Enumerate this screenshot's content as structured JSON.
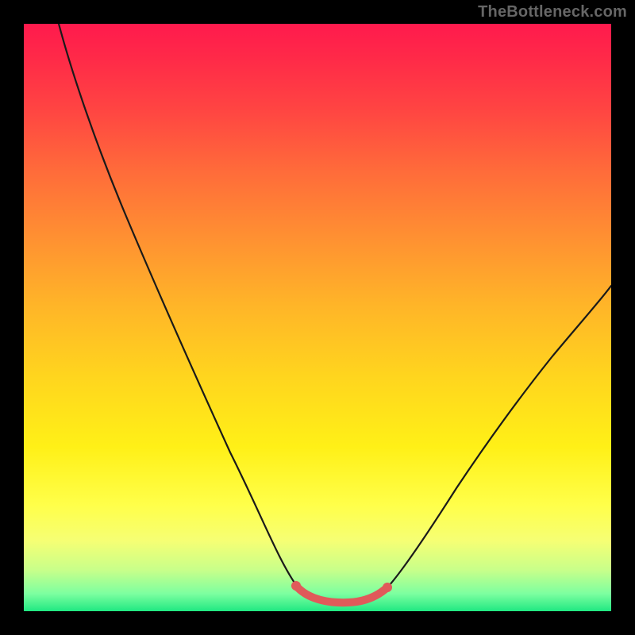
{
  "watermark": "TheBottleneck.com",
  "colors": {
    "frame_bg": "#000000",
    "gradient_top": "#ff1a4d",
    "gradient_bottom": "#20e882",
    "curve": "#1a1a1a",
    "highlight": "#e05a5a",
    "watermark_text": "#666666"
  },
  "chart_data": {
    "type": "line",
    "title": "",
    "xlabel": "",
    "ylabel": "",
    "xlim": [
      0,
      100
    ],
    "ylim": [
      0,
      100
    ],
    "x": [
      6,
      10,
      14,
      18,
      22,
      26,
      30,
      34,
      38,
      42,
      44,
      46,
      48,
      50,
      52,
      54,
      56,
      58,
      60,
      62,
      64,
      68,
      72,
      76,
      80,
      84,
      88,
      92,
      96,
      100
    ],
    "y": [
      100,
      93,
      85,
      77,
      69,
      60,
      51,
      42,
      33,
      22,
      17,
      12,
      8,
      5,
      3,
      2,
      1.5,
      1.5,
      2,
      3,
      5,
      9,
      15,
      22,
      29,
      36,
      42,
      48,
      54,
      59
    ],
    "highlight_range_x": [
      46,
      62
    ],
    "background_gradient_meaning": "severity scale (red high to green low)",
    "note": "Axis values are estimated from pixel positions; the image has no tick labels."
  }
}
